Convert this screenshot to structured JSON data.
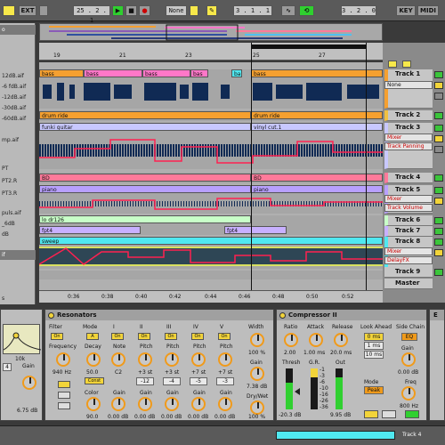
{
  "transport": {
    "ext": "EXT",
    "sig_num": "4",
    "sig_den": "4",
    "tempo": "25 . 2 . 1",
    "quant": "None",
    "position": "3 . 1 . 1",
    "loop_end": "3 . 2 . 0",
    "key": "KEY",
    "midi": "MIDI"
  },
  "browser": {
    "header": "o",
    "items": [
      "12dB.aif",
      "-6 fdB.aif",
      "-12dB.aif",
      "-30dB.aif",
      "-60dB.aif",
      "",
      "mp.aif",
      "",
      "PT",
      "PT2.R",
      "PT3.R",
      "",
      "puls.aif",
      "_6dB",
      "dB",
      "",
      "if",
      "",
      "",
      "s",
      ""
    ]
  },
  "ruler": {
    "bars": [
      "19",
      "21",
      "23",
      "25",
      "27"
    ],
    "times": [
      "0:36",
      "0:38",
      "0:40",
      "0:42",
      "0:44",
      "0:46",
      "0:48",
      "0:50",
      "0:52"
    ]
  },
  "clips": {
    "bass1": "bass",
    "bass2": "bass",
    "bass3": "bass",
    "bass4": "bas",
    "bass5": "ba",
    "bass6": "bass",
    "drum_ride1": "drum ride",
    "drum_ride2": "drum ride",
    "funki_guitar": "funki guitar",
    "vinyl_cut": "vinyl cut.1",
    "bd1": "BD",
    "bd2": "BD",
    "piano1": "piano",
    "piano2": "piano",
    "lo_dr": "lo dr126",
    "fpt4a": "fpt4",
    "fpt4b": "fpt4",
    "sweep": "sweep"
  },
  "tracks": [
    {
      "name": "Track 1",
      "color": "#f5a030",
      "dropdown": "None"
    },
    {
      "name": "Track 2",
      "color": "#f0c040"
    },
    {
      "name": "Track 3",
      "color": "#c8c8ff",
      "dropdown": "Mixer",
      "dropdown2": "Track Panning"
    },
    {
      "name": "Track 4",
      "color": "#ff7a9a"
    },
    {
      "name": "Track 5",
      "color": "#b8a0ff",
      "dropdown": "Mixer",
      "dropdown2": "Track Volume"
    },
    {
      "name": "Track 6",
      "color": "#c8ffc8"
    },
    {
      "name": "Track 7",
      "color": "#c8b0ff"
    },
    {
      "name": "Track 8",
      "color": "#50e8f0",
      "dropdown": "Mixer",
      "dropdown2": "DelayFX"
    },
    {
      "name": "Track 9"
    },
    {
      "name": "Master"
    }
  ],
  "eq": {
    "freq": "10k",
    "gain_label": "Gain",
    "gain": "6.75 dB",
    "val": "4"
  },
  "resonators": {
    "title": "Resonators",
    "filter": "Filter",
    "filter_on": "On",
    "mode_label": "Mode",
    "mode": "A",
    "frequency_label": "Frequency",
    "frequency": "940 Hz",
    "decay_label": "Decay",
    "decay": "50.0",
    "const": "Const",
    "color_label": "Color",
    "color": "90.0",
    "cols": [
      {
        "hdr": "I",
        "on": "On",
        "lbl1": "Note",
        "val1": "C2",
        "lbl2": "Gain",
        "val2": "0.00 dB"
      },
      {
        "hdr": "II",
        "on": "On",
        "lbl1": "Pitch",
        "val1": "+3 st",
        "box": "-12",
        "lbl2": "Gain",
        "val2": "0.00 dB"
      },
      {
        "hdr": "III",
        "on": "On",
        "lbl1": "Pitch",
        "val1": "+3 st",
        "box": "-4",
        "lbl2": "Gain",
        "val2": "0.00 dB"
      },
      {
        "hdr": "IV",
        "on": "On",
        "lbl1": "Pitch",
        "val1": "+7 st",
        "box": "-5",
        "lbl2": "Gain",
        "val2": "0.00 dB"
      },
      {
        "hdr": "V",
        "on": "On",
        "lbl1": "Pitch",
        "val1": "+7 st",
        "box": "-3",
        "lbl2": "Gain",
        "val2": "0.00 dB"
      }
    ],
    "width_label": "Width",
    "width": "100 %",
    "gain_label": "Gain",
    "gain": "7.38 dB",
    "drywet_label": "Dry/Wet",
    "drywet": "100 %"
  },
  "compressor": {
    "title": "Compressor II",
    "ratio_label": "Ratio",
    "ratio": "2.00",
    "attack_label": "Attack",
    "attack": "1.00 ms",
    "release_label": "Release",
    "release": "20.0 ms",
    "lookahead_label": "Look Ahead",
    "lookahead_opts": [
      "0 ms",
      "1 ms",
      "10 ms"
    ],
    "sidechain_label": "Side Chain",
    "sidechain": "EQ",
    "thresh_label": "Thresh",
    "thresh": "-20.3 dB",
    "gr_label": "G.R.",
    "out_label": "Out",
    "out": "9.95 dB",
    "scale": [
      "-1",
      "-3",
      "-6",
      "-10",
      "-16",
      "-26",
      "-36"
    ],
    "mode_label": "Mode",
    "mode": "Peak",
    "gain_label": "Gain",
    "gain": "0.00 dB",
    "freq_label": "Freq",
    "freq": "800 Hz"
  },
  "statusbar": {
    "track": "Track 4"
  },
  "colors": {
    "waveform": "#102a54",
    "envelope": "#ff2050",
    "clip_bass": "#ff77c8",
    "clip_orange": "#f5a030"
  }
}
